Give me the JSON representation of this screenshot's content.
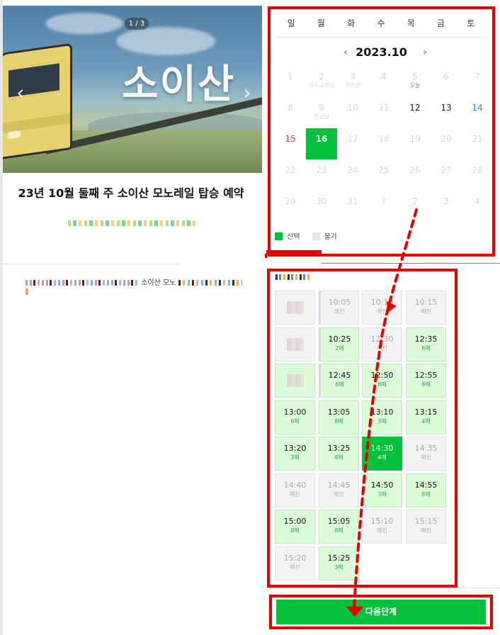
{
  "banner": {
    "counter": "1 / 3",
    "title_text": "소이산",
    "prev_icon": "chevron-left-icon",
    "next_icon": "chevron-right-icon"
  },
  "product": {
    "title": "23년 10월 둘째 주 소이산 모노레일 탑승 예약",
    "desc_visible": "소이산 모노"
  },
  "calendar": {
    "weekdays": [
      "일",
      "월",
      "화",
      "수",
      "목",
      "금",
      "토"
    ],
    "month": "2023.10",
    "prev_label": "‹",
    "next_label": "›",
    "weeks": [
      [
        {
          "d": "1"
        },
        {
          "d": "2",
          "n": "임시공휴일"
        },
        {
          "d": "3",
          "n": "개천절"
        },
        {
          "d": "4"
        },
        {
          "d": "5",
          "n": "오늘"
        },
        {
          "d": "6"
        },
        {
          "d": "7"
        }
      ],
      [
        {
          "d": "8"
        },
        {
          "d": "9",
          "n": "한글날"
        },
        {
          "d": "10"
        },
        {
          "d": "11"
        },
        {
          "d": "12",
          "a": true
        },
        {
          "d": "13",
          "a": true
        },
        {
          "d": "14",
          "a": true,
          "c": "sat"
        }
      ],
      [
        {
          "d": "15",
          "a": true,
          "c": "sun"
        },
        {
          "d": "16",
          "a": true,
          "sel": true
        },
        {
          "d": "17"
        },
        {
          "d": "18"
        },
        {
          "d": "19"
        },
        {
          "d": "20"
        },
        {
          "d": "21"
        }
      ],
      [
        {
          "d": "22"
        },
        {
          "d": "23"
        },
        {
          "d": "24"
        },
        {
          "d": "25"
        },
        {
          "d": "26"
        },
        {
          "d": "27"
        },
        {
          "d": "28"
        }
      ],
      [
        {
          "d": "29"
        },
        {
          "d": "30"
        },
        {
          "d": "31"
        },
        {
          "d": "1"
        },
        {
          "d": "2"
        },
        {
          "d": "3"
        },
        {
          "d": "4"
        }
      ]
    ],
    "legend_selected": "선택",
    "legend_unavailable": "불가"
  },
  "times": {
    "slots": [
      {
        "t": "",
        "s": "",
        "state": "sold",
        "blur": true
      },
      {
        "t": "10:05",
        "s": "매진",
        "state": "sold",
        "bar": true
      },
      {
        "t": "10:10",
        "s": "매진",
        "state": "sold"
      },
      {
        "t": "10:15",
        "s": "매진",
        "state": "sold"
      },
      {
        "t": "",
        "s": "",
        "state": "sold",
        "blur": true
      },
      {
        "t": "10:25",
        "s": "2매",
        "state": "open",
        "bar": true
      },
      {
        "t": "12:30",
        "s": "매진",
        "state": "sold"
      },
      {
        "t": "12:35",
        "s": "8매",
        "state": "open"
      },
      {
        "t": "",
        "s": "",
        "state": "open",
        "blur": true
      },
      {
        "t": "12:45",
        "s": "8매",
        "state": "open",
        "bar": true
      },
      {
        "t": "12:50",
        "s": "8매",
        "state": "open"
      },
      {
        "t": "12:55",
        "s": "8매",
        "state": "open"
      },
      {
        "t": "13:00",
        "s": "6매",
        "state": "open"
      },
      {
        "t": "13:05",
        "s": "8매",
        "state": "open"
      },
      {
        "t": "13:10",
        "s": "3매",
        "state": "open"
      },
      {
        "t": "13:15",
        "s": "4매",
        "state": "open"
      },
      {
        "t": "13:20",
        "s": "3매",
        "state": "open"
      },
      {
        "t": "13:25",
        "s": "8매",
        "state": "open"
      },
      {
        "t": "14:30",
        "s": "4매",
        "state": "selected"
      },
      {
        "t": "14:35",
        "s": "매진",
        "state": "sold"
      },
      {
        "t": "14:40",
        "s": "매진",
        "state": "sold"
      },
      {
        "t": "14:45",
        "s": "매진",
        "state": "sold"
      },
      {
        "t": "14:50",
        "s": "3매",
        "state": "open"
      },
      {
        "t": "14:55",
        "s": "8매",
        "state": "open"
      },
      {
        "t": "15:00",
        "s": "8매",
        "state": "open"
      },
      {
        "t": "15:05",
        "s": "8매",
        "state": "open"
      },
      {
        "t": "15:10",
        "s": "매진",
        "state": "sold"
      },
      {
        "t": "15:15",
        "s": "매진",
        "state": "sold"
      },
      {
        "t": "15:20",
        "s": "매진",
        "state": "sold"
      },
      {
        "t": "15:25",
        "s": "3매",
        "state": "open"
      }
    ]
  },
  "footer": {
    "next_label": "다음단계"
  },
  "colors": {
    "accent": "#05c03d",
    "annotation": "#e60000",
    "slot_open": "#dcfbd8",
    "slot_sold": "#f3f3f3",
    "saturday": "#3f82d9",
    "sunday": "#e23c3c"
  }
}
